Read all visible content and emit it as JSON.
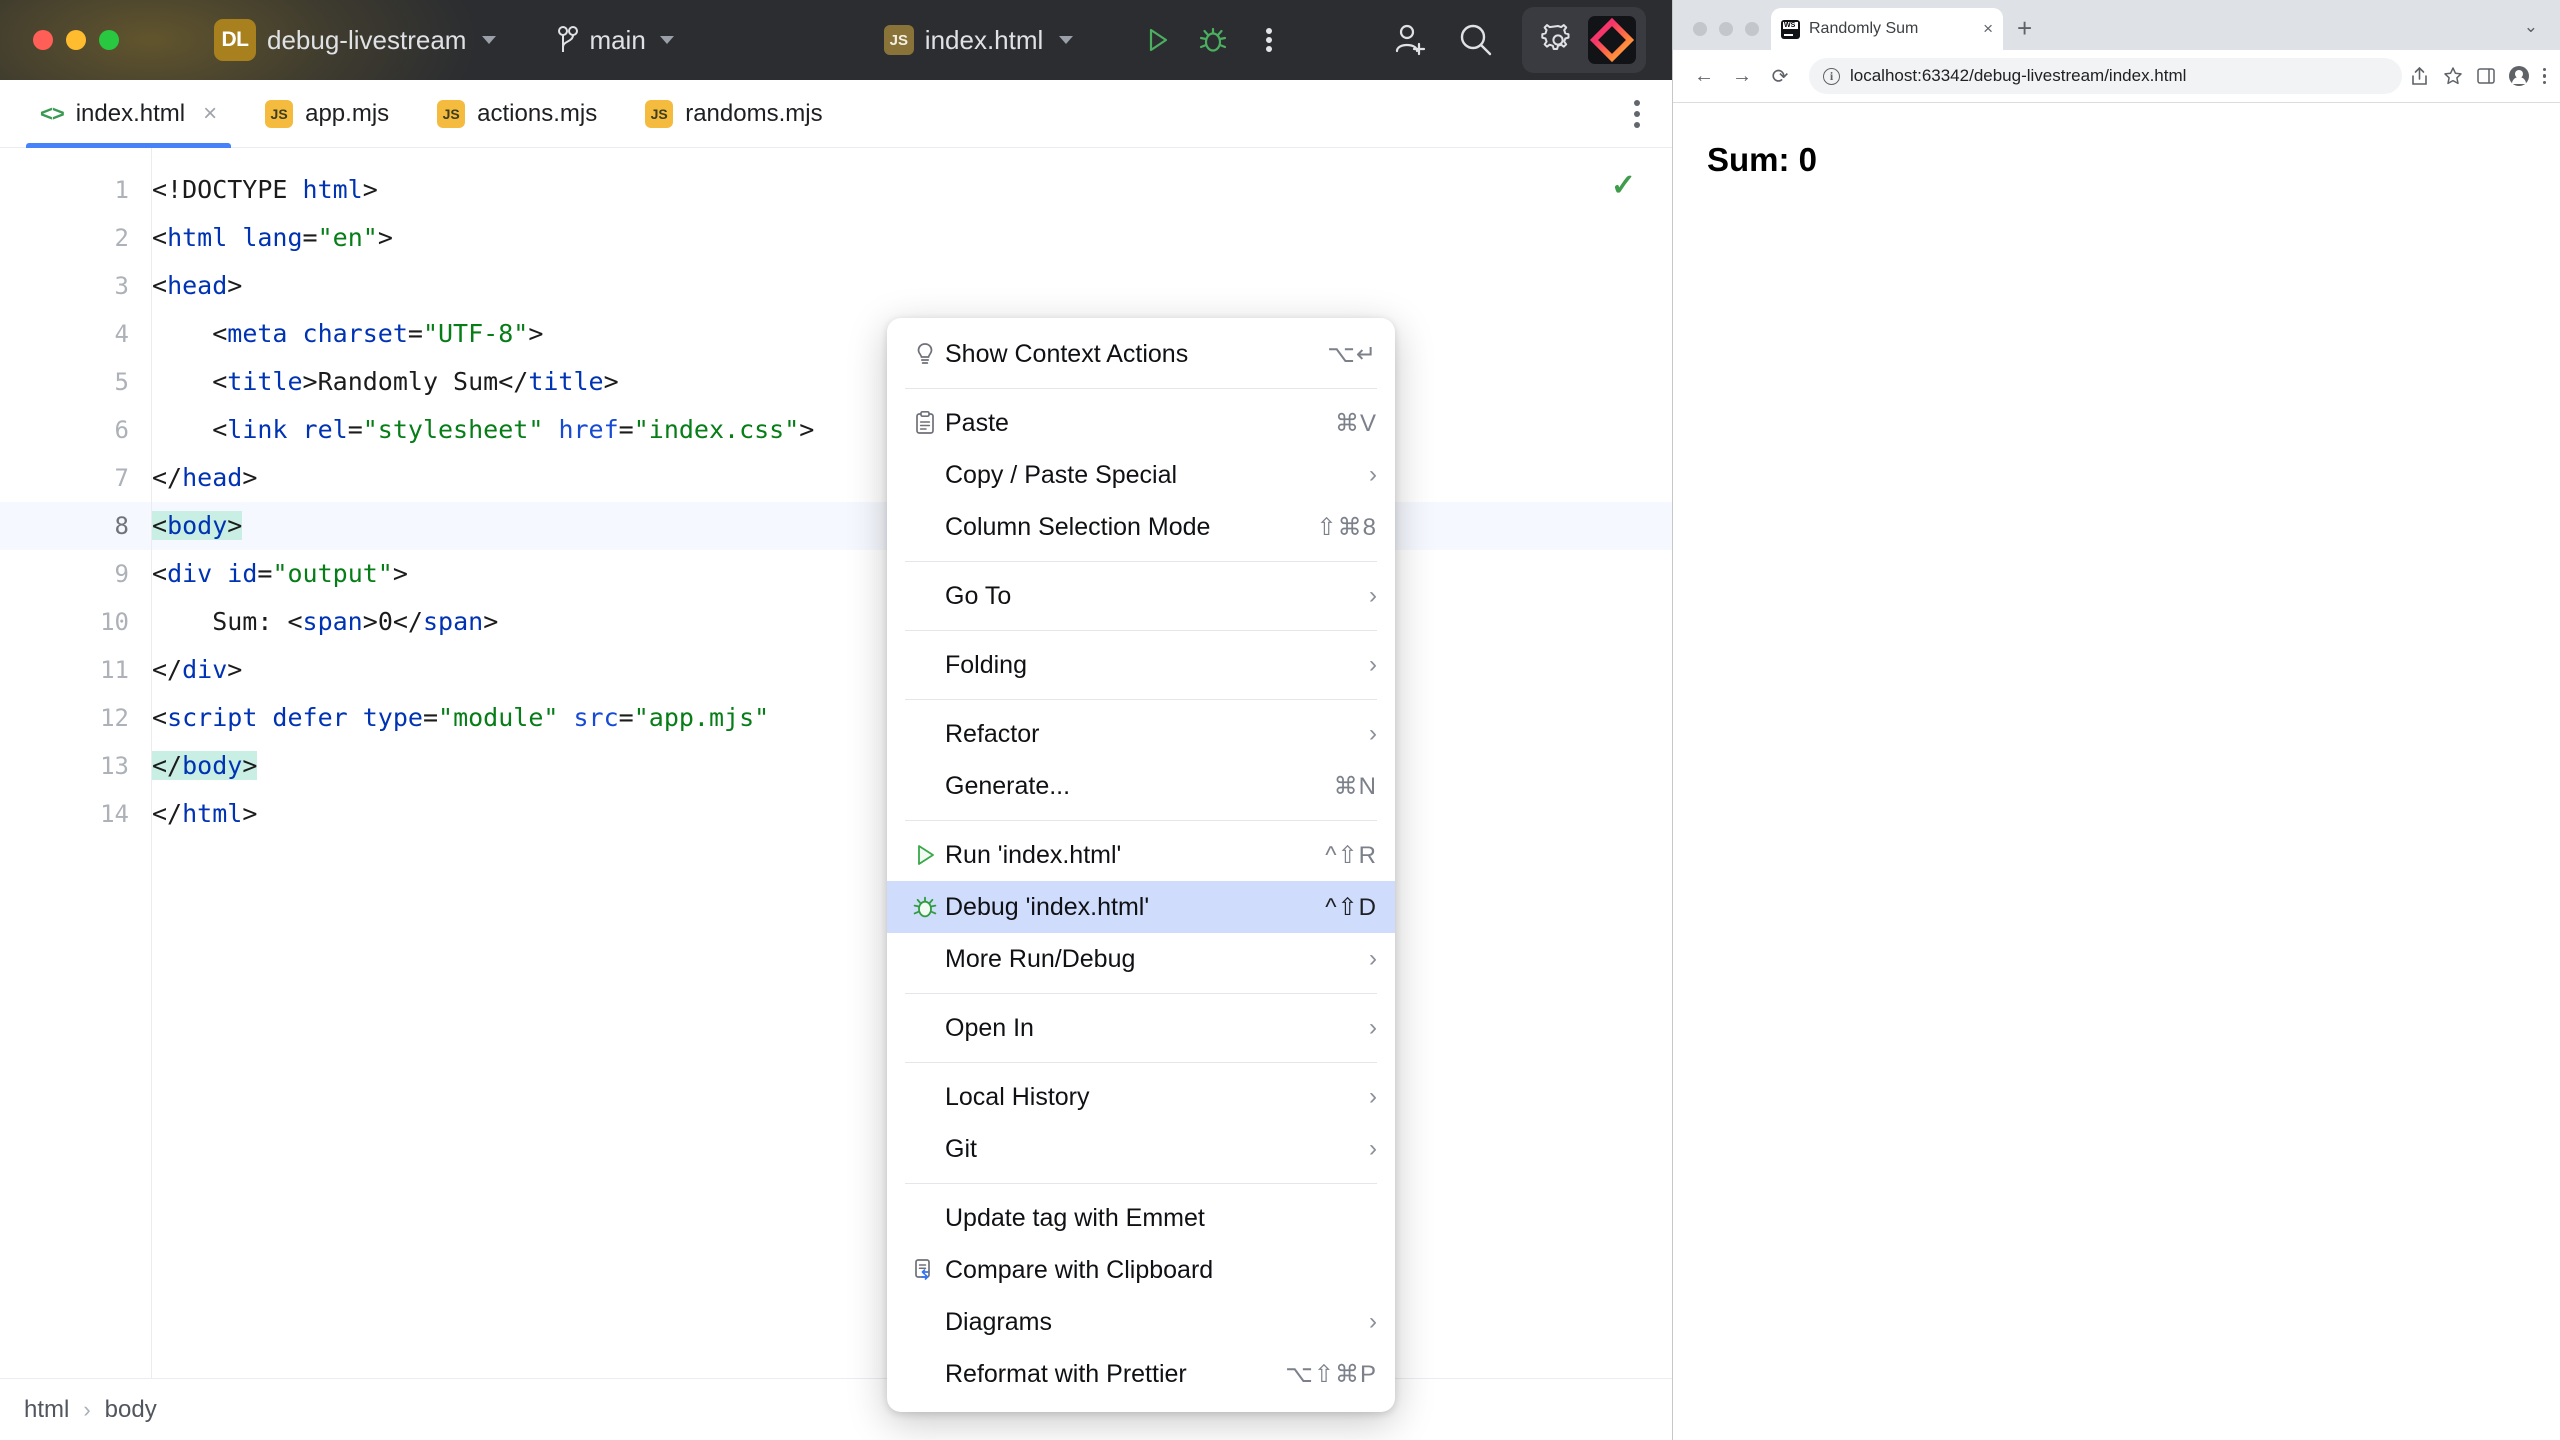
{
  "ide": {
    "titlebar": {
      "project_badge": "DL",
      "project_name": "debug-livestream",
      "branch": "main",
      "file": "index.html",
      "file_badge": "JS",
      "icons": {
        "run": "run-play-icon",
        "debug": "debug-bug-icon",
        "more": "more-vertical-icon",
        "add_user": "add-user-icon",
        "search": "search-icon",
        "settings": "gear-icon",
        "product": "webstorm-logo-icon"
      }
    },
    "tabs": [
      {
        "label": "index.html",
        "icon": "html-tag-icon",
        "active": true,
        "closable": true
      },
      {
        "label": "app.mjs",
        "icon": "js-file-icon",
        "active": false,
        "closable": false
      },
      {
        "label": "actions.mjs",
        "icon": "js-file-icon",
        "active": false,
        "closable": false
      },
      {
        "label": "randoms.mjs",
        "icon": "js-file-icon",
        "active": false,
        "closable": false
      }
    ],
    "editor": {
      "inspection_status": "✓",
      "current_line": 8,
      "lines": [
        {
          "n": 1,
          "tokens": [
            {
              "t": "<!DOCTYPE ",
              "c": "cpunct"
            },
            {
              "t": "html",
              "c": "ctag"
            },
            {
              "t": ">",
              "c": "cpunct"
            }
          ]
        },
        {
          "n": 2,
          "tokens": [
            {
              "t": "<",
              "c": "cpunct"
            },
            {
              "t": "html ",
              "c": "ctag"
            },
            {
              "t": "lang",
              "c": "ctag"
            },
            {
              "t": "=",
              "c": "cpunct"
            },
            {
              "t": "\"en\"",
              "c": "cstr"
            },
            {
              "t": ">",
              "c": "cpunct"
            }
          ]
        },
        {
          "n": 3,
          "tokens": [
            {
              "t": "<",
              "c": "cpunct"
            },
            {
              "t": "head",
              "c": "ctag"
            },
            {
              "t": ">",
              "c": "cpunct"
            }
          ]
        },
        {
          "n": 4,
          "tokens": [
            {
              "t": "    <",
              "c": "cpunct"
            },
            {
              "t": "meta ",
              "c": "ctag"
            },
            {
              "t": "charset",
              "c": "ctag"
            },
            {
              "t": "=",
              "c": "cpunct"
            },
            {
              "t": "\"UTF-8\"",
              "c": "cstr"
            },
            {
              "t": ">",
              "c": "cpunct"
            }
          ]
        },
        {
          "n": 5,
          "tokens": [
            {
              "t": "    <",
              "c": "cpunct"
            },
            {
              "t": "title",
              "c": "ctag"
            },
            {
              "t": ">",
              "c": "cpunct"
            },
            {
              "t": "Randomly Sum",
              "c": "ctext"
            },
            {
              "t": "</",
              "c": "cpunct"
            },
            {
              "t": "title",
              "c": "ctag"
            },
            {
              "t": ">",
              "c": "cpunct"
            }
          ]
        },
        {
          "n": 6,
          "tokens": [
            {
              "t": "    <",
              "c": "cpunct"
            },
            {
              "t": "link ",
              "c": "ctag"
            },
            {
              "t": "rel",
              "c": "ctag"
            },
            {
              "t": "=",
              "c": "cpunct"
            },
            {
              "t": "\"stylesheet\"",
              "c": "cstr"
            },
            {
              "t": " ",
              "c": "cpunct"
            },
            {
              "t": "href",
              "c": "cattr"
            },
            {
              "t": "=",
              "c": "cpunct"
            },
            {
              "t": "\"index.css\"",
              "c": "cstr"
            },
            {
              "t": ">",
              "c": "cpunct"
            }
          ]
        },
        {
          "n": 7,
          "tokens": [
            {
              "t": "</",
              "c": "cpunct"
            },
            {
              "t": "head",
              "c": "ctag"
            },
            {
              "t": ">",
              "c": "cpunct"
            }
          ]
        },
        {
          "n": 8,
          "tokens": [
            {
              "t": "<",
              "c": "cpunct tagmatch"
            },
            {
              "t": "body",
              "c": "ctag tagmatch"
            },
            {
              "t": ">",
              "c": "cpunct tagmatch"
            }
          ]
        },
        {
          "n": 9,
          "tokens": [
            {
              "t": "<",
              "c": "cpunct"
            },
            {
              "t": "div ",
              "c": "ctag"
            },
            {
              "t": "id",
              "c": "ctag"
            },
            {
              "t": "=",
              "c": "cpunct"
            },
            {
              "t": "\"output\"",
              "c": "cstr"
            },
            {
              "t": ">",
              "c": "cpunct"
            }
          ]
        },
        {
          "n": 10,
          "tokens": [
            {
              "t": "    Sum: ",
              "c": "ctext"
            },
            {
              "t": "<",
              "c": "cpunct"
            },
            {
              "t": "span",
              "c": "ctag"
            },
            {
              "t": ">",
              "c": "cpunct"
            },
            {
              "t": "0",
              "c": "ctext"
            },
            {
              "t": "</",
              "c": "cpunct"
            },
            {
              "t": "span",
              "c": "ctag"
            },
            {
              "t": ">",
              "c": "cpunct"
            }
          ]
        },
        {
          "n": 11,
          "tokens": [
            {
              "t": "</",
              "c": "cpunct"
            },
            {
              "t": "div",
              "c": "ctag"
            },
            {
              "t": ">",
              "c": "cpunct"
            }
          ]
        },
        {
          "n": 12,
          "tokens": [
            {
              "t": "<",
              "c": "cpunct"
            },
            {
              "t": "script ",
              "c": "ctag"
            },
            {
              "t": "defer ",
              "c": "ctag"
            },
            {
              "t": "type",
              "c": "ctag"
            },
            {
              "t": "=",
              "c": "cpunct"
            },
            {
              "t": "\"module\"",
              "c": "cstr"
            },
            {
              "t": " ",
              "c": "cpunct"
            },
            {
              "t": "src",
              "c": "cattr"
            },
            {
              "t": "=",
              "c": "cpunct"
            },
            {
              "t": "\"app.mjs\"",
              "c": "cstr"
            }
          ]
        },
        {
          "n": 13,
          "tokens": [
            {
              "t": "</",
              "c": "cpunct tagmatch"
            },
            {
              "t": "body",
              "c": "ctag tagmatch"
            },
            {
              "t": ">",
              "c": "cpunct tagmatch"
            }
          ]
        },
        {
          "n": 14,
          "tokens": [
            {
              "t": "</",
              "c": "cpunct"
            },
            {
              "t": "html",
              "c": "ctag"
            },
            {
              "t": ">",
              "c": "cpunct"
            }
          ]
        }
      ]
    },
    "breadcrumb": {
      "items": [
        "html",
        "body"
      ],
      "separator": "›"
    }
  },
  "context_menu": {
    "groups": [
      [
        {
          "label": "Show Context Actions",
          "shortcut": "⌥↵",
          "icon": "lightbulb-icon",
          "arrow": false,
          "selected": false
        }
      ],
      [
        {
          "label": "Paste",
          "shortcut": "⌘V",
          "icon": "clipboard-icon",
          "arrow": false,
          "selected": false
        },
        {
          "label": "Copy / Paste Special",
          "shortcut": "",
          "icon": "",
          "arrow": true,
          "selected": false
        },
        {
          "label": "Column Selection Mode",
          "shortcut": "⇧⌘8",
          "icon": "",
          "arrow": false,
          "selected": false
        }
      ],
      [
        {
          "label": "Go To",
          "shortcut": "",
          "icon": "",
          "arrow": true,
          "selected": false
        }
      ],
      [
        {
          "label": "Folding",
          "shortcut": "",
          "icon": "",
          "arrow": true,
          "selected": false
        }
      ],
      [
        {
          "label": "Refactor",
          "shortcut": "",
          "icon": "",
          "arrow": true,
          "selected": false
        },
        {
          "label": "Generate...",
          "shortcut": "⌘N",
          "icon": "",
          "arrow": false,
          "selected": false
        }
      ],
      [
        {
          "label": "Run 'index.html'",
          "shortcut": "^⇧R",
          "icon": "run-play-icon",
          "arrow": false,
          "selected": false
        },
        {
          "label": "Debug 'index.html'",
          "shortcut": "^⇧D",
          "icon": "debug-bug-icon",
          "arrow": false,
          "selected": true
        },
        {
          "label": "More Run/Debug",
          "shortcut": "",
          "icon": "",
          "arrow": true,
          "selected": false
        }
      ],
      [
        {
          "label": "Open In",
          "shortcut": "",
          "icon": "",
          "arrow": true,
          "selected": false
        }
      ],
      [
        {
          "label": "Local History",
          "shortcut": "",
          "icon": "",
          "arrow": true,
          "selected": false
        },
        {
          "label": "Git",
          "shortcut": "",
          "icon": "",
          "arrow": true,
          "selected": false
        }
      ],
      [
        {
          "label": "Update tag with Emmet",
          "shortcut": "",
          "icon": "",
          "arrow": false,
          "selected": false
        },
        {
          "label": "Compare with Clipboard",
          "shortcut": "",
          "icon": "compare-clipboard-icon",
          "arrow": false,
          "selected": false
        },
        {
          "label": "Diagrams",
          "shortcut": "",
          "icon": "",
          "arrow": true,
          "selected": false
        },
        {
          "label": "Reformat with Prettier",
          "shortcut": "⌥⇧⌘P",
          "icon": "",
          "arrow": false,
          "selected": false
        }
      ]
    ]
  },
  "browser": {
    "tab": {
      "title": "Randomly Sum",
      "favicon": "webstorm-favicon",
      "close": "×"
    },
    "new_tab": "+",
    "tablist_chevron": "⌄",
    "nav": {
      "back": "←",
      "forward": "→",
      "reload": "⟳"
    },
    "omnibox": {
      "info_icon": "info-circle-icon",
      "url": "localhost:63342/debug-livestream/index.html"
    },
    "actions": {
      "share": "share-icon",
      "bookmark": "star-icon",
      "sidepanel": "side-panel-icon",
      "profile": "avatar-icon",
      "menu": "kebab-menu-icon"
    },
    "page": {
      "heading": "Sum: 0"
    }
  },
  "colors": {
    "ide_titlebar_bg": "#2b2d30",
    "project_accent": "#a8801e",
    "tab_active_underline": "#4682fa",
    "menu_selected_bg": "#cfdcfb",
    "tag_match_highlight": "#c9efe4",
    "current_line_bg": "#f5f8fe",
    "syntax_tag": "#0033b3",
    "syntax_string": "#067d17",
    "run_green": "#3f9c4a",
    "browser_tabbar_bg": "#dee1e6"
  }
}
